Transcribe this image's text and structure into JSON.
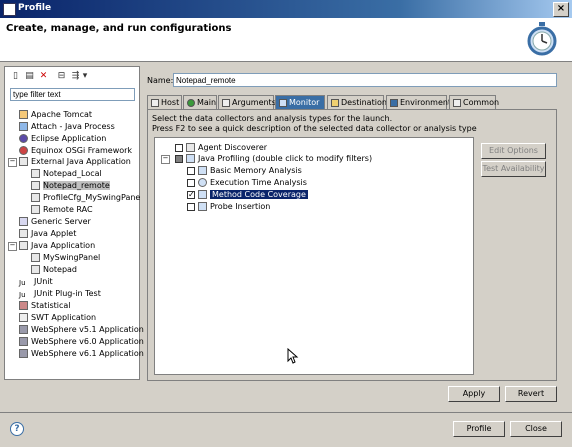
{
  "window": {
    "title": "Profile"
  },
  "header": {
    "title": "Create, manage, and run configurations"
  },
  "left": {
    "filter_value": "type filter text",
    "items": [
      "Apache Tomcat",
      "Attach - Java Process",
      "Eclipse Application",
      "Equinox OSGi Framework",
      "External Java Application",
      "Notepad_Local",
      "Notepad_remote",
      "ProfileCfg_MySwingPane",
      "Remote RAC",
      "Generic Server",
      "Java Applet",
      "Java Application",
      "MySwingPanel",
      "Notepad",
      "JUnit",
      "JUnit Plug-in Test",
      "Statistical",
      "SWT Application",
      "WebSphere v5.1 Application",
      "WebSphere v6.0 Application",
      "WebSphere v6.1 Application"
    ]
  },
  "name": {
    "label": "Name:",
    "value": "Notepad_remote"
  },
  "tabs": [
    "Host",
    "Main",
    "Arguments",
    "Monitor",
    "Destination",
    "Environment",
    "Common"
  ],
  "monitor": {
    "desc1": "Select the data collectors and analysis types for the launch.",
    "desc2": "Press F2 to see a quick description of the selected data collector or analysis type",
    "items": [
      "Agent Discoverer",
      "Java Profiling (double click to modify filters)",
      "Basic Memory Analysis",
      "Execution Time Analysis",
      "Method Code Coverage",
      "Probe Insertion"
    ],
    "edit_options": "Edit Options",
    "test_availability": "Test Availability"
  },
  "buttons": {
    "apply": "Apply",
    "revert": "Revert",
    "profile": "Profile",
    "close": "Close"
  },
  "help": "?",
  "colors": {
    "selection": "#0a246a",
    "title_bar": "#0a246a"
  }
}
